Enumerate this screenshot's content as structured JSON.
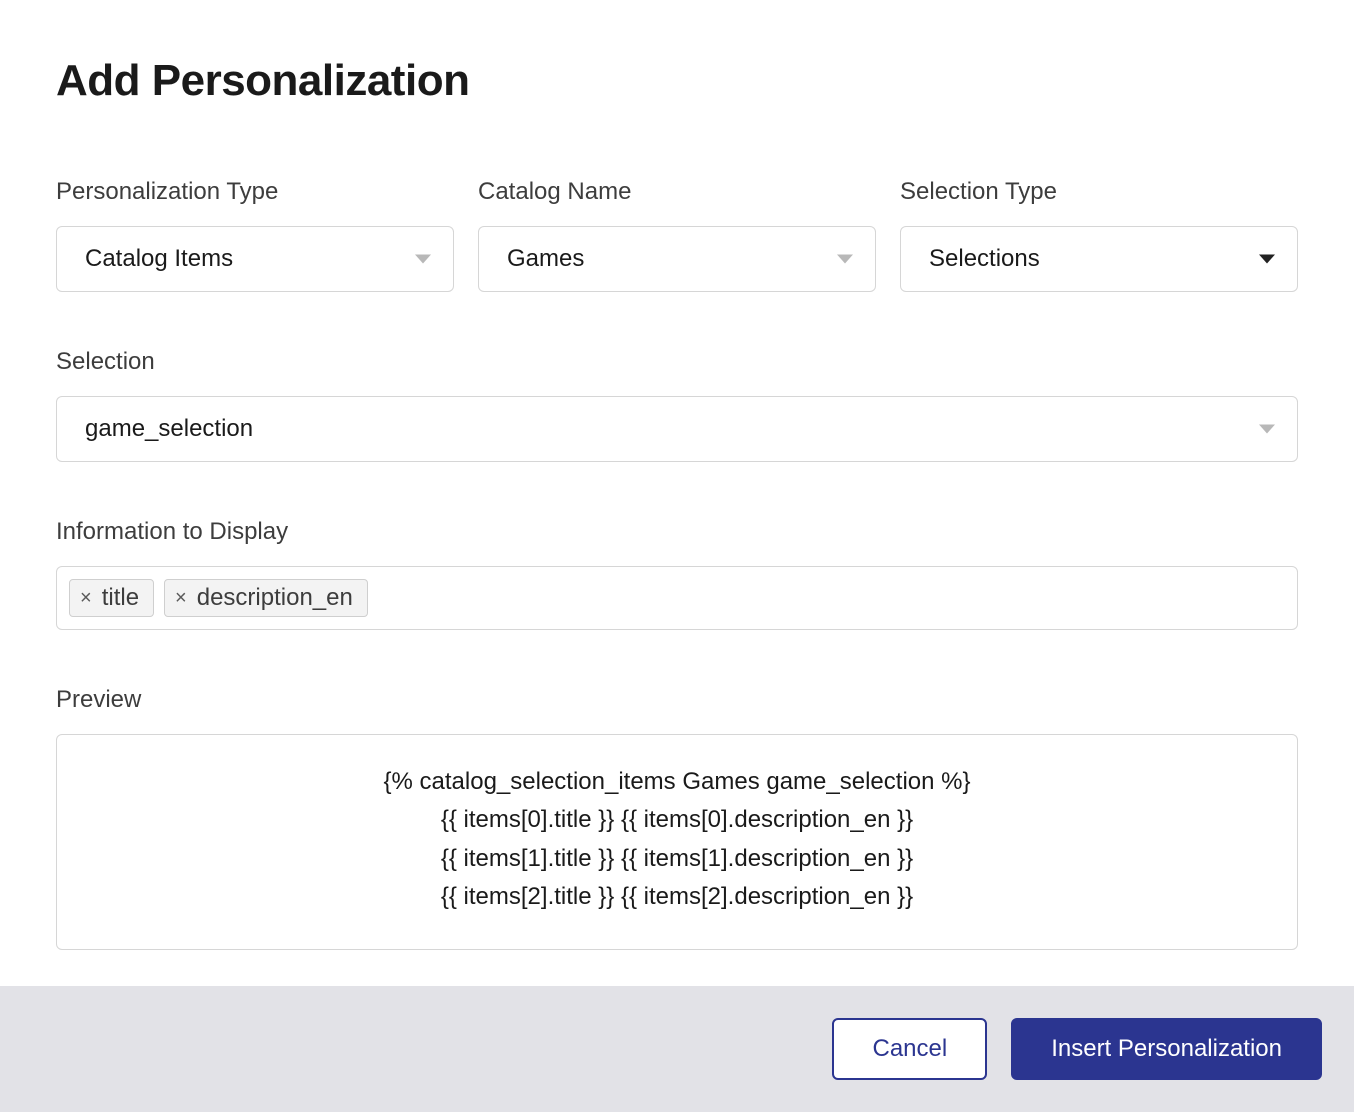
{
  "header": {
    "title": "Add Personalization"
  },
  "fields": {
    "personalization_type": {
      "label": "Personalization Type",
      "value": "Catalog Items"
    },
    "catalog_name": {
      "label": "Catalog Name",
      "value": "Games"
    },
    "selection_type": {
      "label": "Selection Type",
      "value": "Selections"
    },
    "selection": {
      "label": "Selection",
      "value": "game_selection"
    },
    "info_to_display": {
      "label": "Information to Display",
      "tags": [
        "title",
        "description_en"
      ]
    },
    "preview": {
      "label": "Preview",
      "content": "{% catalog_selection_items Games game_selection %}\n{{ items[0].title }} {{ items[0].description_en }}\n{{ items[1].title }} {{ items[1].description_en }}\n{{ items[2].title }} {{ items[2].description_en }}"
    }
  },
  "footer": {
    "cancel": "Cancel",
    "insert": "Insert Personalization"
  }
}
